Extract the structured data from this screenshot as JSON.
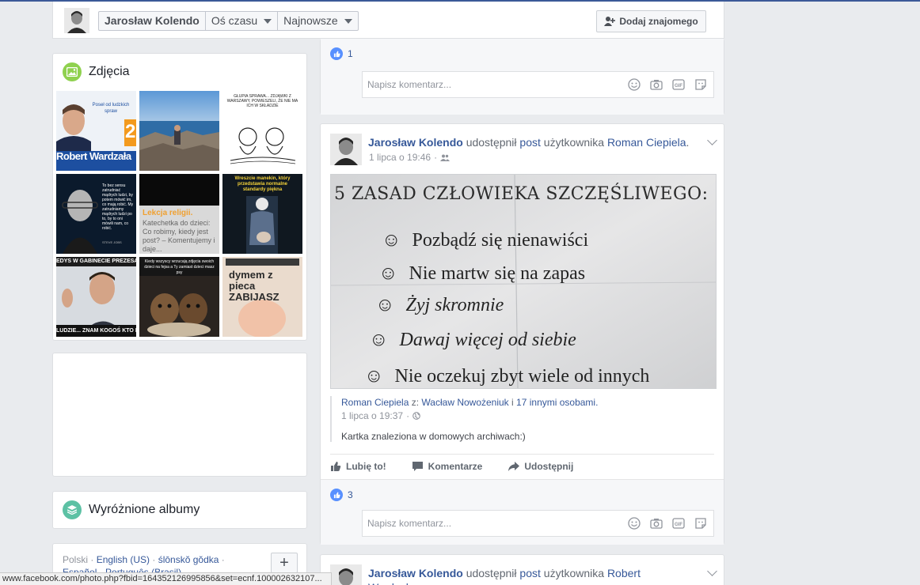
{
  "header": {
    "profile_name": "Jarosław Kolendo",
    "timeline_label": "Oś czasu",
    "sort_label": "Najnowsze",
    "add_friend_label": "Dodaj znajomego"
  },
  "photos": {
    "title": "Zdjęcia",
    "tiles": [
      {
        "text": "Poseł od ludzkich spraw",
        "sub": "Robert Wardzała",
        "num": "2"
      },
      {
        "text": ""
      },
      {
        "text": "GŁUPIA SPRAWA... ZDJĄWKI Z WARSZAWY, POWIESZELI, ŻE NIE MA ICH W SKŁADZIE"
      },
      {
        "text": "To bez sensu zatrudniać mądrych ludzi, by potem mówić im, co mają robić. My zatrudniamy mądrych ludzi po to, by to oni mówili nam, co robić.",
        "sub": "STEVE JOBS"
      },
      {
        "text": "Lekcja religii.",
        "sub": "Katechetka do dzieci: Co robimy, kiedy jest post? – Komentujemy i daje..."
      },
      {
        "text": "Wreszcie manekin, który przedstawia normalne standardy piękna"
      },
      {
        "text": "LUDZIE... ZNAM KOGOŚ KTO B",
        "top": "EDYS W GABINECIE PREZESA"
      },
      {
        "text": "Kiedy wszyscy wrzucają zdjęcia swoich dzieci na fejsa a Ty zamiast dzieci masz psy"
      },
      {
        "text": "dymem z pieca ZABIJASZ"
      }
    ]
  },
  "albums": {
    "title": "Wyróżnione albumy"
  },
  "languages": {
    "items": [
      "Polski",
      "English (US)",
      "ślōnskŏ gŏdka",
      "Español",
      "Português (Brasil)"
    ],
    "plus": "+"
  },
  "post1": {
    "likes": "1",
    "comment_placeholder": "Napisz komentarz..."
  },
  "post2": {
    "author": "Jarosław Kolendo",
    "verb": "udostępnił",
    "obj": "post",
    "of_user": "użytkownika",
    "orig_author": "Roman Ciepiela",
    "time": "1 lipca o 19:46",
    "note": {
      "title": "5 ZASAD CZŁOWIEKA SZCZĘŚLIWEGO:",
      "rules": [
        "Pozbądź się nienawiści",
        "Nie martw się na zapas",
        "Żyj skromnie",
        "Dawaj więcej od siebie",
        "Nie oczekuj zbyt wiele od innych"
      ]
    },
    "shared": {
      "author": "Roman Ciepiela",
      "with_prefix": "z:",
      "with_user": "Wacław Nowożeniuk",
      "and_text": "i",
      "others": "17 innymi osobami.",
      "time": "1 lipca o 19:37",
      "text": "Kartka znaleziona w domowych archiwach:)"
    },
    "actions": {
      "like": "Lubię to!",
      "comment": "Komentarze",
      "share": "Udostępnij"
    },
    "likes": "3",
    "comment_placeholder": "Napisz komentarz..."
  },
  "post3": {
    "author": "Jarosław Kolendo",
    "verb": "udostępnił",
    "obj": "post",
    "of_user": "użytkownika",
    "orig_author": "Robert Wardzała"
  },
  "status_url": "www.facebook.com/photo.php?fbid=164352126995856&set=ecnf.100002632107..."
}
